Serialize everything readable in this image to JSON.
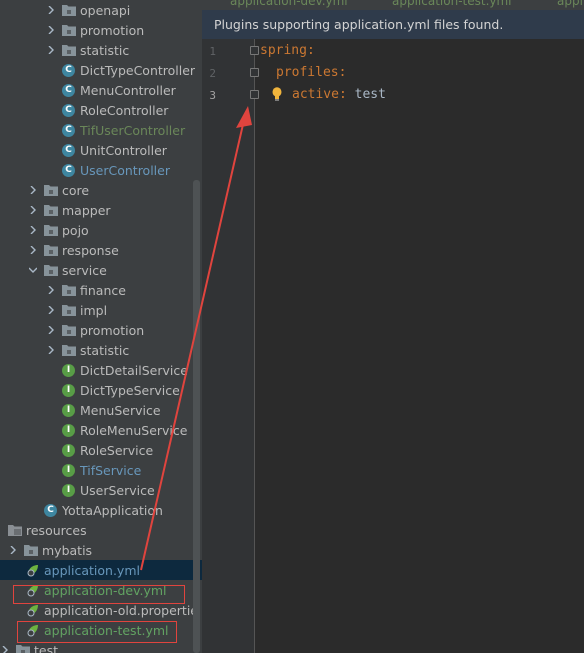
{
  "tree": {
    "items": [
      {
        "label": "openapi",
        "kind": "folder",
        "expanded": false
      },
      {
        "label": "promotion",
        "kind": "folder",
        "expanded": false
      },
      {
        "label": "statistic",
        "kind": "folder",
        "expanded": false
      },
      {
        "label": "DictTypeController",
        "kind": "class",
        "color": "default"
      },
      {
        "label": "MenuController",
        "kind": "class",
        "color": "default"
      },
      {
        "label": "RoleController",
        "kind": "class",
        "color": "default"
      },
      {
        "label": "TifUserController",
        "kind": "class",
        "color": "green"
      },
      {
        "label": "UnitController",
        "kind": "class",
        "color": "default"
      },
      {
        "label": "UserController",
        "kind": "class",
        "color": "blue"
      },
      {
        "label": "core",
        "kind": "folder",
        "expanded": false
      },
      {
        "label": "mapper",
        "kind": "folder",
        "expanded": false
      },
      {
        "label": "pojo",
        "kind": "folder",
        "expanded": false
      },
      {
        "label": "response",
        "kind": "folder",
        "expanded": false
      },
      {
        "label": "service",
        "kind": "folder",
        "expanded": true
      },
      {
        "label": "finance",
        "kind": "folder",
        "expanded": false
      },
      {
        "label": "impl",
        "kind": "folder",
        "expanded": false
      },
      {
        "label": "promotion",
        "kind": "folder",
        "expanded": false
      },
      {
        "label": "statistic",
        "kind": "folder",
        "expanded": false
      },
      {
        "label": "DictDetailService",
        "kind": "interface",
        "color": "default"
      },
      {
        "label": "DictTypeService",
        "kind": "interface",
        "color": "default"
      },
      {
        "label": "MenuService",
        "kind": "interface",
        "color": "default"
      },
      {
        "label": "RoleMenuService",
        "kind": "interface",
        "color": "default"
      },
      {
        "label": "RoleService",
        "kind": "interface",
        "color": "default"
      },
      {
        "label": "TifService",
        "kind": "interface",
        "color": "blue"
      },
      {
        "label": "UserService",
        "kind": "interface",
        "color": "default"
      },
      {
        "label": "YottaApplication",
        "kind": "app",
        "color": "default"
      },
      {
        "label": "resources",
        "kind": "resfolder",
        "expanded": true
      },
      {
        "label": "mybatis",
        "kind": "folder",
        "expanded": false
      },
      {
        "label": "application.yml",
        "kind": "yml",
        "color": "blue",
        "selected": true
      },
      {
        "label": "application-dev.yml",
        "kind": "yml",
        "color": "green"
      },
      {
        "label": "application-old.propertie",
        "kind": "yml",
        "color": "default"
      },
      {
        "label": "application-test.yml",
        "kind": "yml",
        "color": "green"
      },
      {
        "label": "test",
        "kind": "folder",
        "expanded": false
      }
    ]
  },
  "editor": {
    "tabs": [
      "application-dev.yml",
      "application-test.yml",
      "appl"
    ],
    "banner": "Plugins supporting application.yml files found.",
    "line_numbers": [
      "1",
      "2",
      "3"
    ],
    "lines": [
      {
        "key": "spring",
        "colon": ":",
        "value": ""
      },
      {
        "key": "profiles",
        "colon": ":",
        "value": ""
      },
      {
        "key": "active",
        "colon": ":",
        "value": " test"
      }
    ]
  },
  "colors": {
    "annotation_red": "#e0443e",
    "accent_blue": "#6897bb",
    "vcs_green": "#6a8759"
  }
}
